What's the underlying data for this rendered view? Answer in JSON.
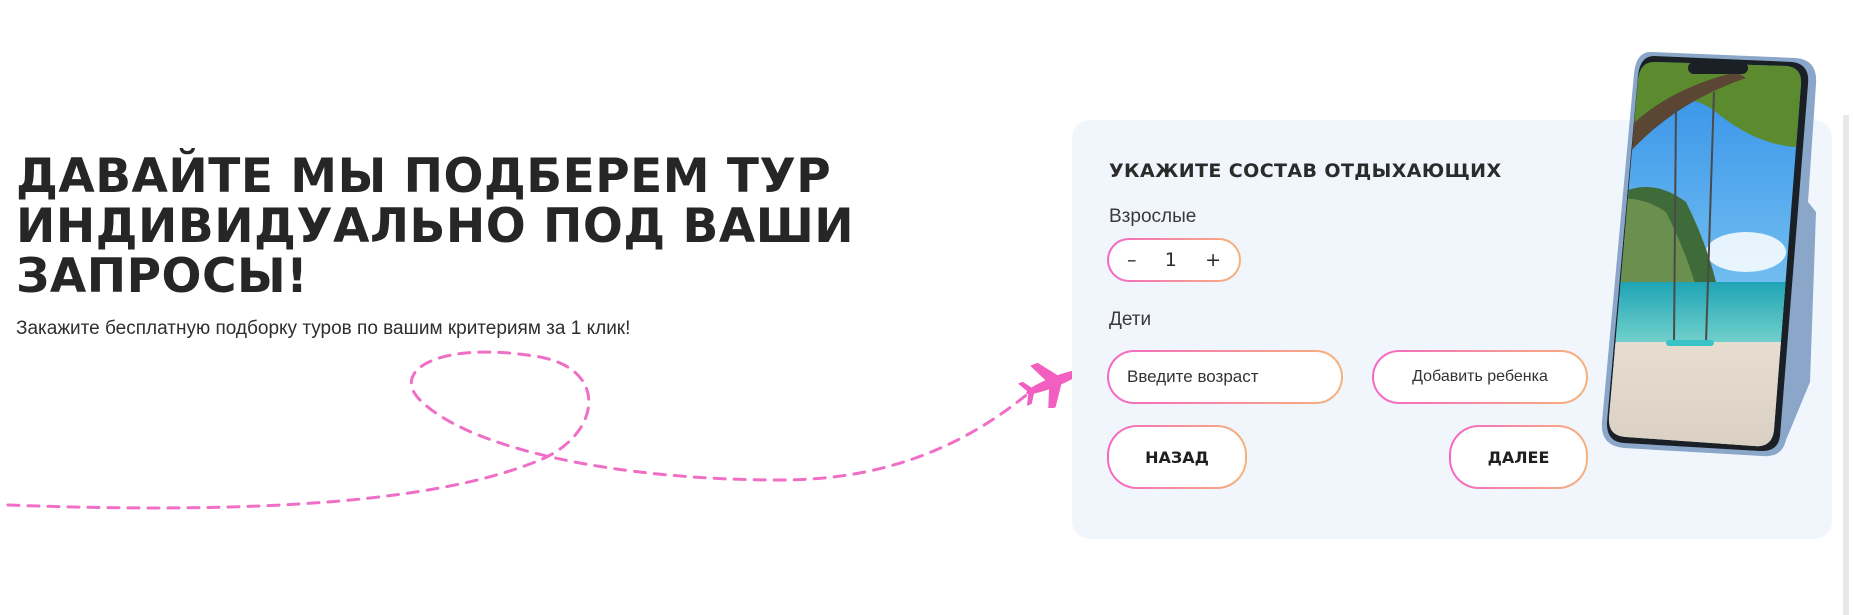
{
  "hero": {
    "title_lines": [
      "ДАВАЙТЕ МЫ ПОДБЕРЕМ ТУР",
      "ИНДИВИДУАЛЬНО ПОД ВАШИ",
      "ЗАПРОСЫ!"
    ],
    "subtitle": "Закажите бесплатную подборку туров по вашим критериям за 1 клик!"
  },
  "form": {
    "title": "УКАЖИТЕ СОСТАВ ОТДЫХАЮЩИХ",
    "adults_label": "Взрослые",
    "adults_value": "1",
    "minus_label": "–",
    "plus_label": "+",
    "children_label": "Дети",
    "age_placeholder": "Введите возраст",
    "add_child_label": "Добавить ребенка",
    "back_label": "НАЗАД",
    "next_label": "ДАЛЕЕ"
  },
  "colors": {
    "accent_pink": "#f368c4",
    "accent_orange": "#f7b27a",
    "card_bg": "#f1f5fc"
  },
  "icons": {
    "plane": "airplane-icon",
    "phone": "phone-mockup-image"
  }
}
